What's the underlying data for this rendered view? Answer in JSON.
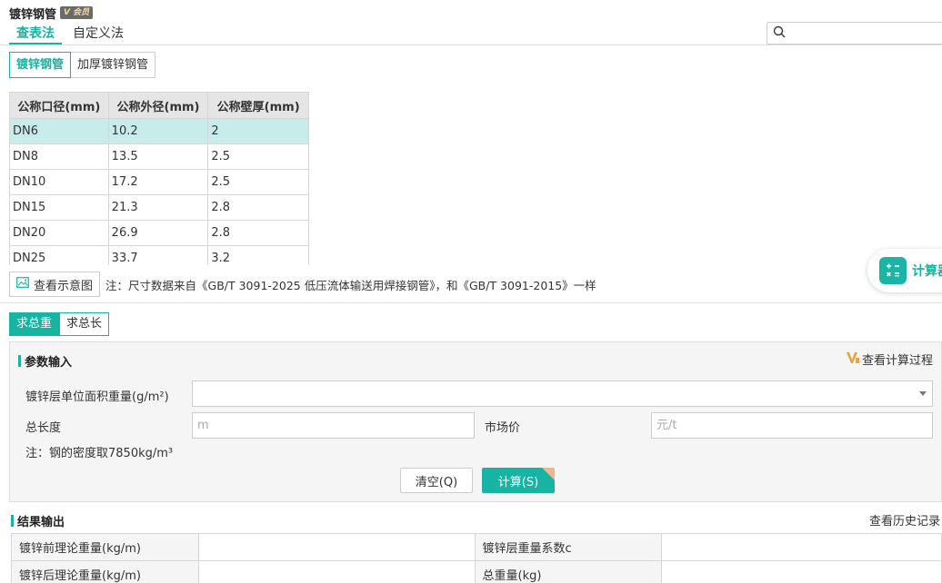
{
  "header": {
    "title": "镀锌钢管",
    "vip_badge": "会员"
  },
  "top_tabs": [
    {
      "label": "查表法",
      "active": true
    },
    {
      "label": "自定义法",
      "active": false
    }
  ],
  "search": {
    "icon": "search-icon",
    "placeholder": ""
  },
  "sub_tabs": [
    {
      "label": "镀锌钢管",
      "active": true
    },
    {
      "label": "加厚镀锌钢管",
      "active": false
    }
  ],
  "spec_table": {
    "headers": [
      "公称口径(mm)",
      "公称外径(mm)",
      "公称壁厚(mm)"
    ],
    "rows": [
      [
        "DN6",
        "10.2",
        "2"
      ],
      [
        "DN8",
        "13.5",
        "2.5"
      ],
      [
        "DN10",
        "17.2",
        "2.5"
      ],
      [
        "DN15",
        "21.3",
        "2.8"
      ],
      [
        "DN20",
        "26.9",
        "2.8"
      ],
      [
        "DN25",
        "33.7",
        "3.2"
      ]
    ],
    "selected_row": 0
  },
  "diagram": {
    "button_label": "查看示意图",
    "note": "注：尺寸数据来自《GB/T 3091-2025 低压流体输送用焊接钢管》，和《GB/T 3091-2015》一样"
  },
  "calculator_float": {
    "label": "计算器"
  },
  "mode_tabs": [
    {
      "label": "求总重",
      "active": true
    },
    {
      "label": "求总长",
      "active": false
    }
  ],
  "params": {
    "title": "参数输入",
    "process_link": "查看计算过程",
    "zinc_label": "镀锌层单位面积重量(g/m²)",
    "zinc_value": "",
    "length_label": "总长度",
    "length_placeholder": "m",
    "price_label": "市场价",
    "price_placeholder": "元/t",
    "density_note": "注：钢的密度取7850kg/m³",
    "clear_label": "清空(Q)",
    "calc_label": "计算(S)"
  },
  "results": {
    "title": "结果输出",
    "history_link": "查看历史记录",
    "rows": [
      {
        "k1": "镀锌前理论重量(kg/m)",
        "v1": "",
        "k2": "镀锌层重量系数c",
        "v2": ""
      },
      {
        "k1": "镀锌后理论重量(kg/m)",
        "v1": "",
        "k2": "总重量(kg)",
        "v2": ""
      }
    ]
  },
  "colors": {
    "accent": "#17b3a3",
    "selected_row": "#c8ecea",
    "header_bg": "#e5e5e5"
  }
}
